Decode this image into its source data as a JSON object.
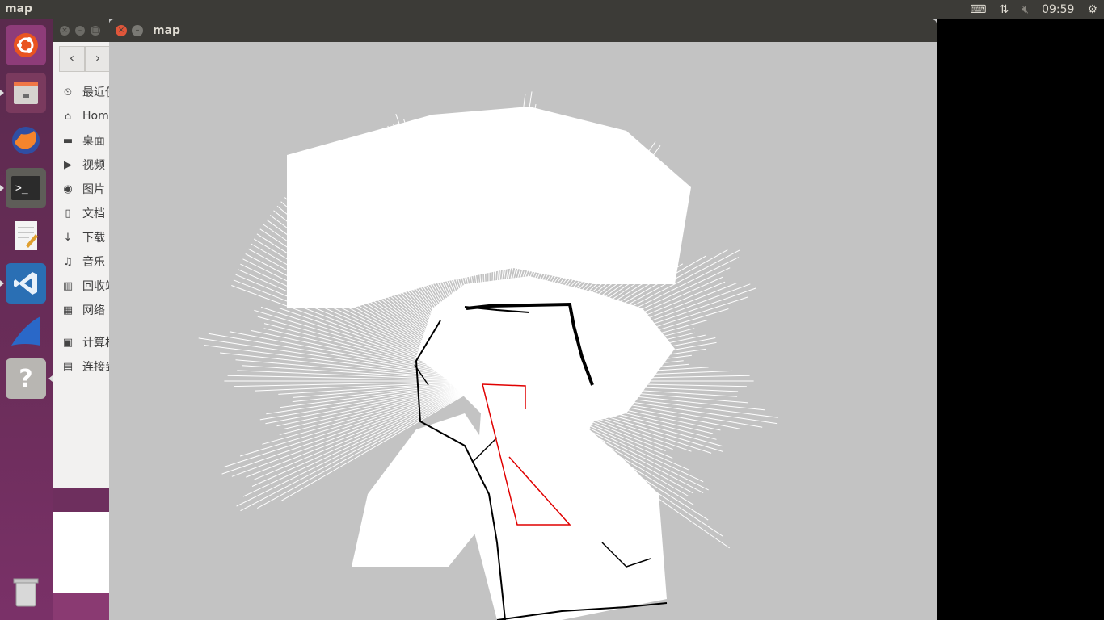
{
  "topbar": {
    "app_title": "map",
    "clock": "09:59",
    "tray_icons": [
      "keyboard-icon",
      "network-icon",
      "volume-muted-icon",
      "settings-icon"
    ]
  },
  "launcher": {
    "items": [
      "ubuntu-logo-icon",
      "files-icon",
      "firefox-icon",
      "terminal-icon",
      "text-editor-icon",
      "vscode-icon",
      "wireshark-icon",
      "help-icon",
      "trash-icon"
    ]
  },
  "files": {
    "sidebar": [
      {
        "icon": "clock-icon",
        "label": "最近使"
      },
      {
        "icon": "home-icon",
        "label": "Home"
      },
      {
        "icon": "folder-icon",
        "label": "桌面"
      },
      {
        "icon": "video-icon",
        "label": "视频"
      },
      {
        "icon": "camera-icon",
        "label": "图片"
      },
      {
        "icon": "document-icon",
        "label": "文档"
      },
      {
        "icon": "download-icon",
        "label": "下载"
      },
      {
        "icon": "music-icon",
        "label": "音乐"
      },
      {
        "icon": "trash-icon",
        "label": "回收站"
      },
      {
        "icon": "network-icon",
        "label": "网络"
      },
      {
        "icon": "computer-icon",
        "label": "计算机"
      },
      {
        "icon": "server-icon",
        "label": "连接到"
      }
    ]
  },
  "map_window": {
    "title": "map",
    "background": "#c3c3c3",
    "free_color": "#ffffff",
    "wall_color": "#000000",
    "path_color": "#e00000"
  }
}
